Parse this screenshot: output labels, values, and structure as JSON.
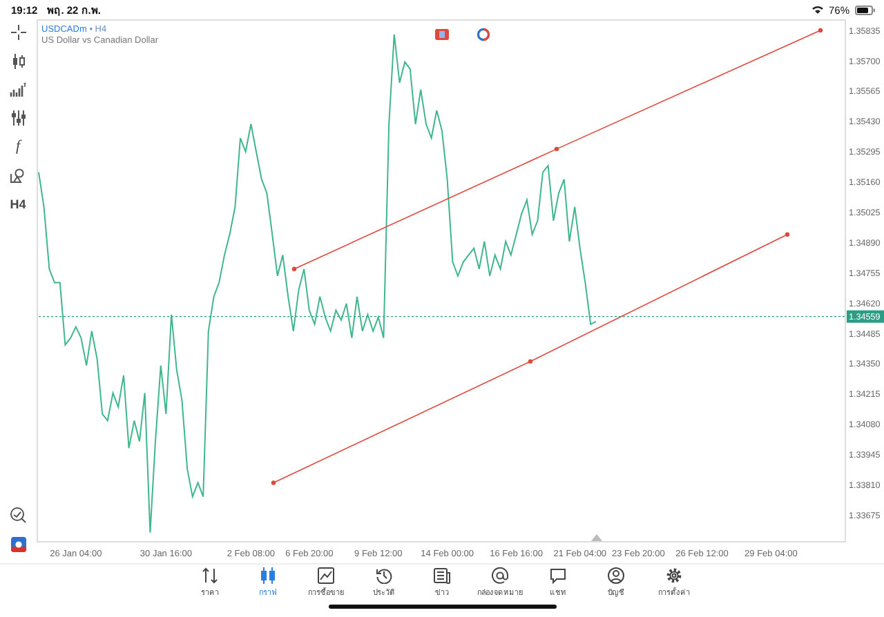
{
  "status_bar": {
    "time": "19:12",
    "date": "พฤ. 22 ก.พ.",
    "battery": "76%"
  },
  "toolbar": [
    {
      "kind": "crosshair"
    },
    {
      "kind": "candles"
    },
    {
      "kind": "indicators"
    },
    {
      "kind": "sliders"
    },
    {
      "kind": "text",
      "label": "f"
    },
    {
      "kind": "shapes"
    },
    {
      "kind": "text",
      "label": "H4"
    }
  ],
  "toolbar_bottom": [
    {
      "kind": "chat"
    },
    {
      "kind": "logo"
    }
  ],
  "chart": {
    "symbol": "USDCADm",
    "timeframe": "• H4",
    "description": "US Dollar vs Canadian Dollar",
    "chart_data": {
      "type": "line",
      "categories": [
        null,
        null,
        null,
        null,
        null,
        null,
        null,
        "26 Jan 04:00",
        null,
        null,
        null,
        null,
        null,
        null,
        null,
        null,
        null,
        null,
        null,
        null,
        null,
        null,
        null,
        null,
        "30 Jan 16:00",
        null,
        null,
        null,
        null,
        null,
        null,
        null,
        null,
        null,
        null,
        null,
        null,
        null,
        null,
        null,
        "2 Feb 08:00",
        null,
        null,
        null,
        null,
        null,
        null,
        null,
        null,
        null,
        null,
        "6 Feb 20:00",
        null,
        null,
        null,
        null,
        null,
        null,
        null,
        null,
        null,
        null,
        null,
        null,
        "9 Feb 12:00",
        null,
        null,
        null,
        null,
        null,
        null,
        null,
        null,
        null,
        null,
        null,
        null,
        "14 Feb 00:00",
        null,
        null,
        null,
        null,
        null,
        null,
        null,
        null,
        null,
        null,
        null,
        null,
        "16 Feb 16:00",
        null,
        null,
        null,
        null,
        null,
        null,
        null,
        null,
        null,
        null,
        null,
        "21 Feb 04:00",
        null,
        null,
        null,
        null,
        null,
        null,
        null,
        null,
        null,
        null,
        "23 Feb 20:00",
        null,
        null,
        null,
        null,
        null,
        null,
        null,
        null,
        null,
        null,
        null,
        "26 Feb 12:00",
        null,
        null,
        null,
        null,
        null,
        null,
        null,
        null,
        null,
        null,
        null,
        null,
        "29 Feb 04:00",
        null,
        null,
        null,
        null,
        null,
        null,
        null,
        null,
        null,
        null,
        null,
        null,
        null,
        null
      ],
      "series": [
        {
          "color": "#3fb68b",
          "values": [
            1.35202,
            1.35048,
            1.34771,
            1.3471,
            1.3471,
            1.34433,
            1.34464,
            1.34513,
            1.34464,
            1.34341,
            1.34494,
            1.34371,
            1.34125,
            1.34095,
            1.34218,
            1.34156,
            1.34297,
            1.33972,
            1.34095,
            1.34002,
            1.34218,
            1.33596,
            1.34002,
            1.34341,
            1.34125,
            1.34568,
            1.34322,
            1.34187,
            1.33879,
            1.33756,
            1.33818,
            1.33756,
            1.34494,
            1.34648,
            1.3471,
            1.34833,
            1.34925,
            1.35048,
            1.35355,
            1.35294,
            1.35417,
            1.35294,
            1.35171,
            1.35109,
            1.34925,
            1.3474,
            1.34833,
            1.34648,
            1.34494,
            1.34679,
            1.34771,
            1.34587,
            1.34525,
            1.34648,
            1.34556,
            1.34494,
            1.34587,
            1.34543,
            1.34617,
            1.34464,
            1.34648,
            1.34494,
            1.34568,
            1.34494,
            1.34556,
            1.34464,
            1.35417,
            1.35817,
            1.35601,
            1.35694,
            1.35663,
            1.35417,
            1.35571,
            1.35417,
            1.35355,
            1.35478,
            1.35386,
            1.35171,
            1.34802,
            1.3474,
            1.34802,
            1.34833,
            1.34863,
            1.34771,
            1.34894,
            1.3474,
            1.34833,
            1.34771,
            1.34894,
            1.34833,
            1.34925,
            1.35017,
            1.35079,
            1.34925,
            1.34986,
            1.35202,
            1.35232,
            1.34986,
            1.35109,
            1.35171,
            1.34894,
            1.35048,
            1.34863,
            1.3471,
            1.34525,
            1.34537,
            null,
            null,
            null,
            null,
            null,
            null,
            null,
            null,
            null,
            null,
            null,
            null,
            null,
            null,
            null,
            null,
            null,
            null,
            null,
            null,
            null,
            null,
            null,
            null,
            null,
            null,
            null,
            null,
            null,
            null,
            null,
            null,
            null,
            null,
            null,
            null,
            null,
            null,
            null,
            null,
            null,
            null,
            null,
            null,
            null,
            null,
            null
          ]
        }
      ],
      "ylim": [
        1.33558,
        1.35884
      ],
      "yticks": [
        {
          "value": 1.35835,
          "label": "1.35835"
        },
        {
          "value": 1.357,
          "label": "1.35700"
        },
        {
          "value": 1.35565,
          "label": "1.35565"
        },
        {
          "value": 1.3543,
          "label": "1.35430"
        },
        {
          "value": 1.35295,
          "label": "1.35295"
        },
        {
          "value": 1.3516,
          "label": "1.35160"
        },
        {
          "value": 1.35025,
          "label": "1.35025"
        },
        {
          "value": 1.3489,
          "label": "1.34890"
        },
        {
          "value": 1.34755,
          "label": "1.34755"
        },
        {
          "value": 1.3462,
          "label": "1.34620"
        },
        {
          "value": 1.34485,
          "label": "1.34485"
        },
        {
          "value": 1.3435,
          "label": "1.34350"
        },
        {
          "value": 1.34215,
          "label": "1.34215"
        },
        {
          "value": 1.3408,
          "label": "1.34080"
        },
        {
          "value": 1.33945,
          "label": "1.33945"
        },
        {
          "value": 1.3381,
          "label": "1.33810"
        },
        {
          "value": 1.33675,
          "label": "1.33675"
        }
      ],
      "ref_lines": [
        {
          "axis": "y",
          "value": 1.34559,
          "label": "1.34559"
        }
      ]
    }
  },
  "nav": [
    {
      "label": "ราคา",
      "selected": false
    },
    {
      "label": "กราฟ",
      "selected": true
    },
    {
      "label": "การซื้อขาย",
      "selected": false
    },
    {
      "label": "ประวัติ",
      "selected": false
    },
    {
      "label": "ข่าว",
      "selected": false
    },
    {
      "label": "กล่องจดหมาย",
      "selected": false
    },
    {
      "label": "แชท",
      "selected": false
    },
    {
      "label": "บัญชี",
      "selected": false
    },
    {
      "label": "การตั้งค่า",
      "selected": false
    }
  ]
}
